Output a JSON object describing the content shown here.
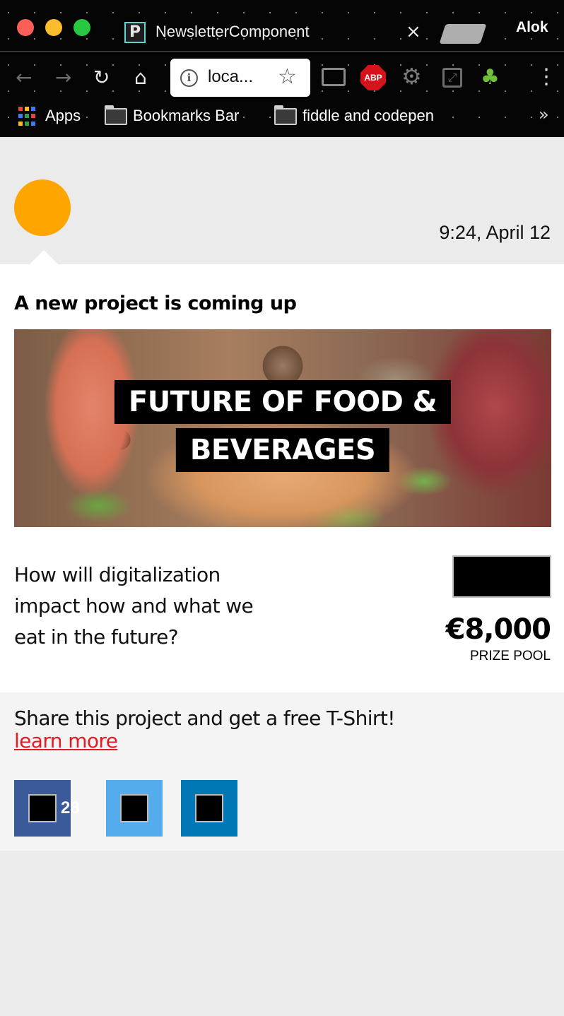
{
  "window": {
    "tab_title": "NewsletterComponent",
    "tab_close_glyph": "×",
    "profile_name": "Alok",
    "favicon_letter": "P"
  },
  "toolbar": {
    "back_glyph": "←",
    "forward_glyph": "→",
    "reload_glyph": "↻",
    "home_glyph": "⌂",
    "url": "loca...",
    "info_glyph": "i",
    "star_glyph": "☆",
    "abp_label": "ABP",
    "gear_glyph": "⚙",
    "resize_glyph": "⤢",
    "bonsai_glyph": "♣",
    "menu_glyph": "⋮"
  },
  "bookmarks": {
    "apps_label": "Apps",
    "items": [
      {
        "label": "Bookmarks Bar"
      },
      {
        "label": "fiddle and codepen"
      }
    ],
    "more_glyph": "»",
    "apps_colors": [
      "#e8453c",
      "#f9bb2d",
      "#3b7ded",
      "#3b7ded",
      "#2ca24c",
      "#e8453c",
      "#f9bb2d",
      "#2ca24c",
      "#3b7ded"
    ]
  },
  "post": {
    "timestamp": "9:24, April 12",
    "avatar_color": "#fea500",
    "title": "A new project is coming up",
    "hero_lines": [
      "FUTURE OF FOOD &",
      "BEVERAGES"
    ],
    "question": "How will digitalization impact how and what we eat in the future?",
    "prize_amount": "€8,000",
    "prize_label": "PRIZE POOL"
  },
  "share": {
    "text": "Share this project and get a free T-Shirt!",
    "learn_more": "learn more",
    "learn_more_color": "#e51b23",
    "buttons": [
      {
        "network": "facebook",
        "icon": "facebook-icon",
        "color": "#3a5a9a",
        "count": "28"
      },
      {
        "network": "twitter",
        "icon": "twitter-icon",
        "color": "#55aced"
      },
      {
        "network": "linkedin",
        "icon": "linkedin-icon",
        "color": "#0077b5"
      }
    ]
  }
}
